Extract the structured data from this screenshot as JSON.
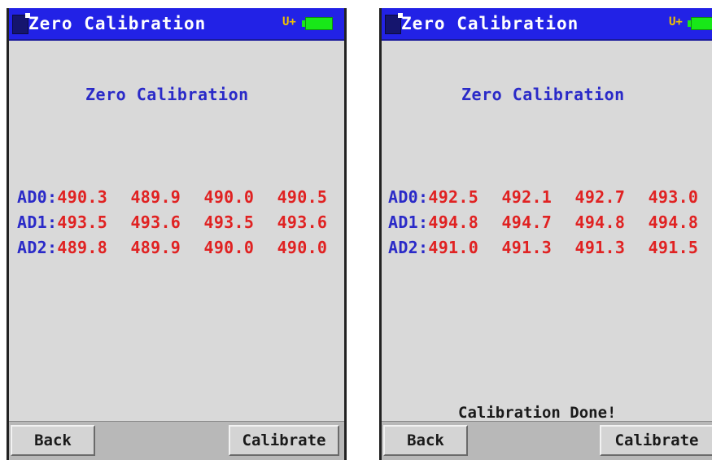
{
  "screens": [
    {
      "title": "Zero Calibration",
      "usb_indicator": "U+",
      "heading": "Zero Calibration",
      "rows": [
        {
          "label": "AD0",
          "values": [
            "490.3",
            "489.9",
            "490.0",
            "490.5"
          ]
        },
        {
          "label": "AD1",
          "values": [
            "493.5",
            "493.6",
            "493.5",
            "493.6"
          ]
        },
        {
          "label": "AD2",
          "values": [
            "489.8",
            "489.9",
            "490.0",
            "490.0"
          ]
        }
      ],
      "status": "",
      "back_label": "Back",
      "calibrate_label": "Calibrate"
    },
    {
      "title": "Zero Calibration",
      "usb_indicator": "U+",
      "heading": "Zero Calibration",
      "rows": [
        {
          "label": "AD0",
          "values": [
            "492.5",
            "492.1",
            "492.7",
            "493.0"
          ]
        },
        {
          "label": "AD1",
          "values": [
            "494.8",
            "494.7",
            "494.8",
            "494.8"
          ]
        },
        {
          "label": "AD2",
          "values": [
            "491.0",
            "491.3",
            "491.3",
            "491.5"
          ]
        }
      ],
      "status": "Calibration Done!",
      "back_label": "Back",
      "calibrate_label": "Calibrate"
    }
  ],
  "colors": {
    "title_bar": "#2222e6",
    "label_blue": "#2a2ac8",
    "value_red": "#e02222",
    "screen_bg": "#d9d9d9",
    "battery_green": "#18e818"
  },
  "icons": [
    "app-icon",
    "usb-icon",
    "battery-icon"
  ]
}
